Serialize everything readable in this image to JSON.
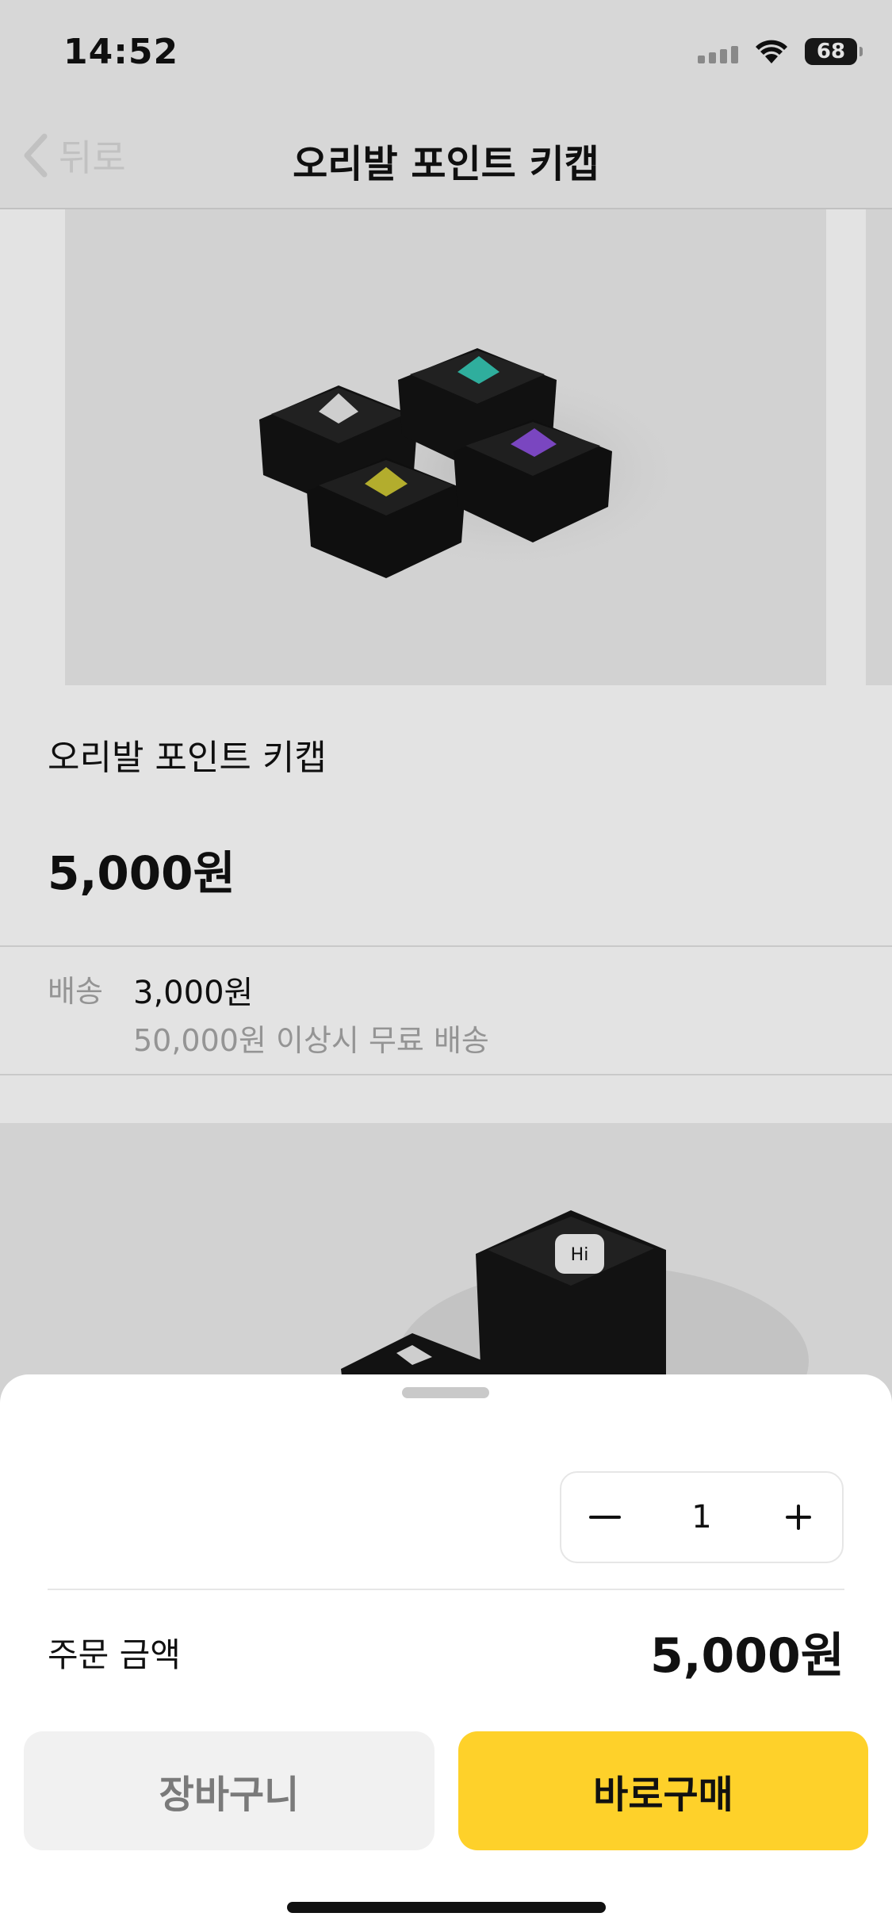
{
  "status_bar": {
    "time": "14:52",
    "battery": "68",
    "icons": [
      "signal-icon",
      "wifi-icon",
      "battery-icon"
    ]
  },
  "nav": {
    "back_label": "뒤로",
    "title": "오리발 포인트 키캡"
  },
  "product": {
    "name": "오리발 포인트 키캡",
    "price": "5,000원",
    "image": "keycaps-product-image",
    "accent_colors": [
      "#e8e8e8",
      "#35c4b1",
      "#c9c333",
      "#8a4fd8"
    ]
  },
  "shipping": {
    "label": "배송",
    "fee": "3,000원",
    "note": "50,000원 이상시 무료 배송"
  },
  "sheet": {
    "quantity": "1",
    "decrement_icon": "minus-icon",
    "increment_icon": "plus-icon",
    "order_label": "주문 금액",
    "order_amount": "5,000원",
    "cart_label": "장바구니",
    "buy_label": "바로구매"
  },
  "colors": {
    "buy_button": "#fed12a",
    "cart_button": "#f1f1f1"
  }
}
